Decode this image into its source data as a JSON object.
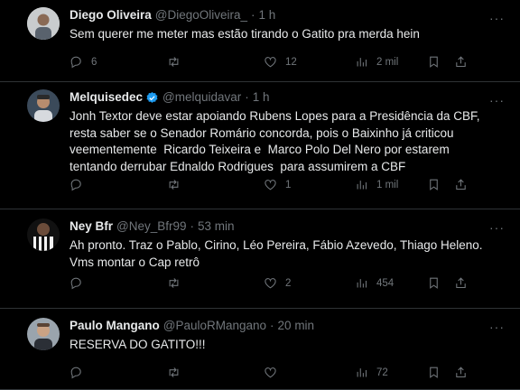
{
  "tweets": [
    {
      "name": "Diego Oliveira",
      "handle": "@DiegoOliveira_",
      "time": "1 h",
      "verified": false,
      "text": "Sem querer me meter mas estão tirando o Gatito pra merda hein",
      "replies": "6",
      "retweets": "",
      "likes": "12",
      "views": "2 mil"
    },
    {
      "name": "Melquisedec",
      "handle": "@melquidavar",
      "time": "1 h",
      "verified": true,
      "text": "Jonh Textor deve estar apoiando Rubens Lopes para a Presidência da CBF,\nresta saber se o Senador Romário concorda, pois o Baixinho já criticou\nveementemente  Ricardo Teixeira e  Marco Polo Del Nero por estarem\ntentando derrubar Ednaldo Rodrigues  para assumirem a CBF",
      "replies": "",
      "retweets": "",
      "likes": "1",
      "views": "1 mil"
    },
    {
      "name": "Ney Bfr",
      "handle": "@Ney_Bfr99",
      "time": "53 min",
      "verified": false,
      "text": "Ah pronto. Traz o Pablo, Cirino, Léo Pereira, Fábio Azevedo, Thiago Heleno.\nVms montar o Cap retrô",
      "replies": "",
      "retweets": "",
      "likes": "2",
      "views": "454"
    },
    {
      "name": "Paulo Mangano",
      "handle": "@PauloRMangano",
      "time": "20 min",
      "verified": false,
      "text": "RESERVA DO GATITO!!!",
      "replies": "",
      "retweets": "",
      "likes": "",
      "views": "72"
    }
  ],
  "separator": "·",
  "more_glyph": "···",
  "colors": {
    "background": "#000000",
    "text": "#e7e9ea",
    "muted": "#71767b",
    "border": "#2f3336",
    "verified": "#1d9bf0"
  }
}
